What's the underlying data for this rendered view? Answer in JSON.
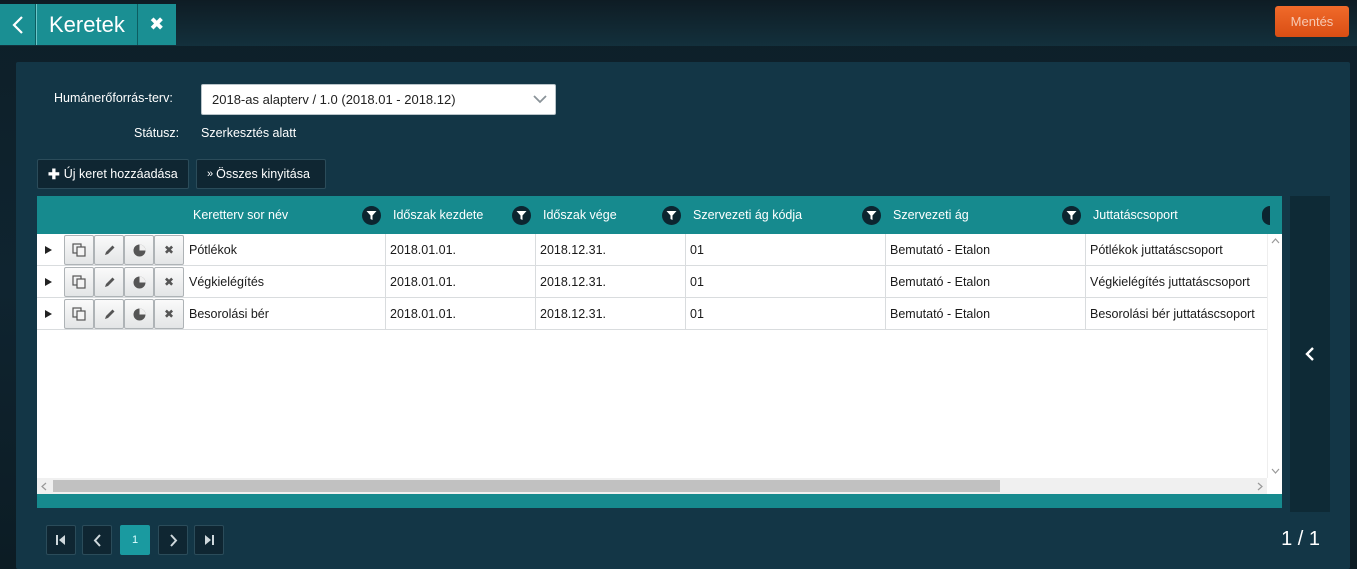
{
  "header": {
    "title": "Keretek",
    "save_label": "Mentés"
  },
  "form": {
    "plan_label": "Humánerőforrás-terv:",
    "plan_value": "2018-as alapterv / 1.0 (2018.01 - 2018.12)",
    "status_label": "Státusz:",
    "status_value": "Szerkesztés alatt"
  },
  "toolbar": {
    "add_label": "Új keret hozzáadása",
    "expand_label": "Összes kinyitása"
  },
  "grid": {
    "columns": [
      "Keretterv sor név",
      "Időszak kezdete",
      "Időszak vége",
      "Szervezeti ág kódja",
      "Szervezeti ág",
      "Juttatáscsoport"
    ],
    "rows": [
      [
        "Pótlékok",
        "2018.01.01.",
        "2018.12.31.",
        "01",
        "Bemutató - Etalon",
        "Pótlékok juttatáscsoport"
      ],
      [
        "Végkielégítés",
        "2018.01.01.",
        "2018.12.31.",
        "01",
        "Bemutató - Etalon",
        "Végkielégítés juttatáscsoport"
      ],
      [
        "Besorolási bér",
        "2018.01.01.",
        "2018.12.31.",
        "01",
        "Bemutató - Etalon",
        "Besorolási bér juttatáscsoport"
      ]
    ]
  },
  "pager": {
    "current_page": "1",
    "page_count": "1 / 1"
  },
  "colors": {
    "accent": "#1a8f93",
    "save": "#e55a1c",
    "panel": "#133646"
  }
}
